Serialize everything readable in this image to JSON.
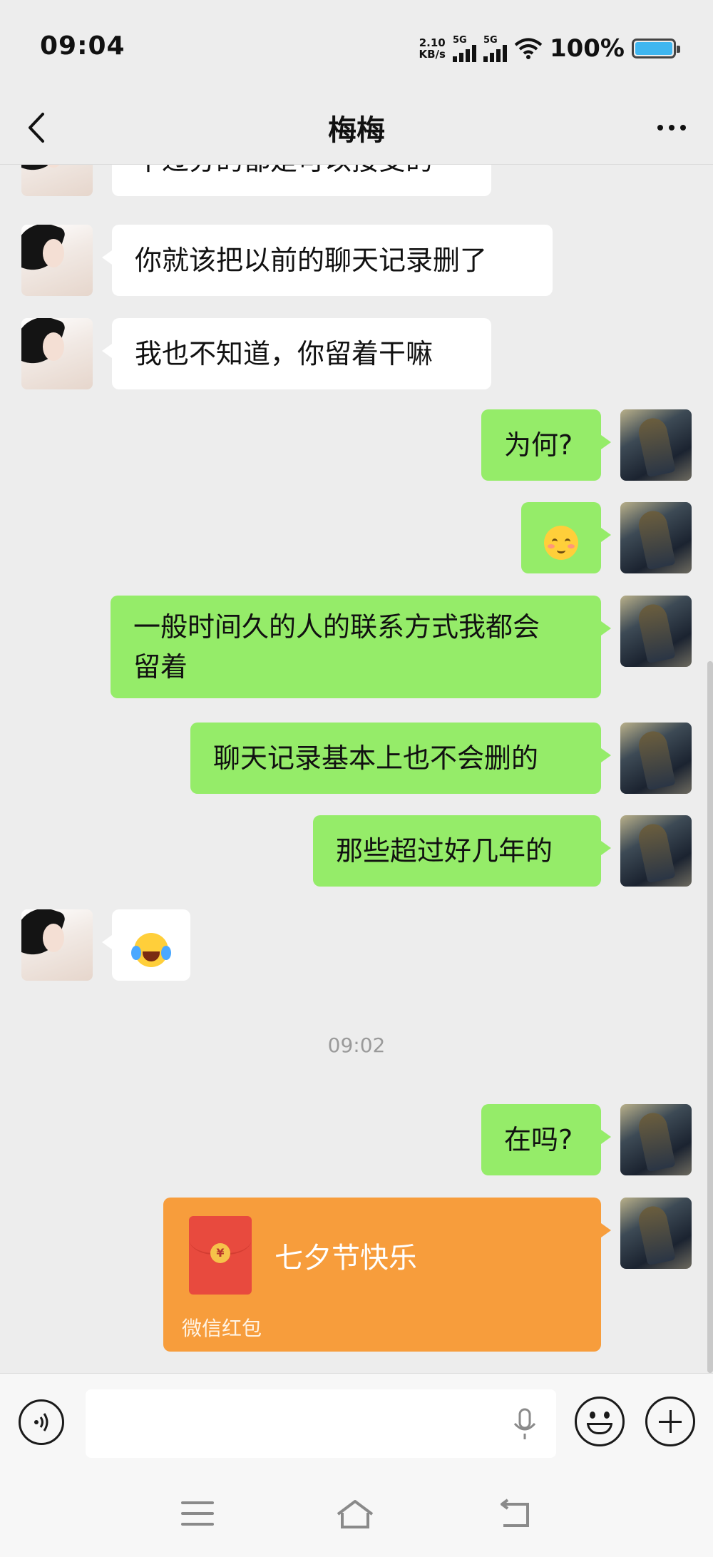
{
  "status_bar": {
    "time": "09:04",
    "net_speed_value": "2.10",
    "net_speed_unit": "KB/s",
    "sim1_label": "5G",
    "sim2_label": "5G",
    "battery_percent": "100%",
    "battery_level": 1.0,
    "battery_color": "#3fb6f0"
  },
  "header": {
    "title": "梅梅",
    "back_icon": "chevron-left-icon",
    "more_icon": "more-dots-icon"
  },
  "messages": [
    {
      "side": "her",
      "text": "不过分的都是可以接受的"
    },
    {
      "side": "her",
      "text": "你就该把以前的聊天记录删了"
    },
    {
      "side": "her",
      "text": "我也不知道，你留着干嘛"
    },
    {
      "side": "me",
      "text": "为何?"
    },
    {
      "side": "me",
      "emoji": "blushing-smile-emoji"
    },
    {
      "side": "me",
      "text_line1": "一般时间久的人的联系方式我都会",
      "text_line2": "留着"
    },
    {
      "side": "me",
      "text": "聊天记录基本上也不会删的"
    },
    {
      "side": "me",
      "text": "那些超过好几年的"
    },
    {
      "side": "her",
      "emoji": "laughing-crying-emoji"
    },
    {
      "side": "me",
      "text": "在吗?"
    }
  ],
  "timestamp": "09:02",
  "red_packet": {
    "title": "七夕节快乐",
    "footer": "微信红包",
    "coin_symbol": "¥",
    "color": "#f79d3c"
  },
  "colors": {
    "my_bubble": "#95ec69",
    "her_bubble": "#ffffff",
    "background": "#ededed"
  },
  "input_bar": {
    "voice_icon": "voice-icon",
    "mic_icon": "microphone-icon",
    "emoji_icon": "emoji-face-icon",
    "plus_icon": "plus-icon"
  }
}
